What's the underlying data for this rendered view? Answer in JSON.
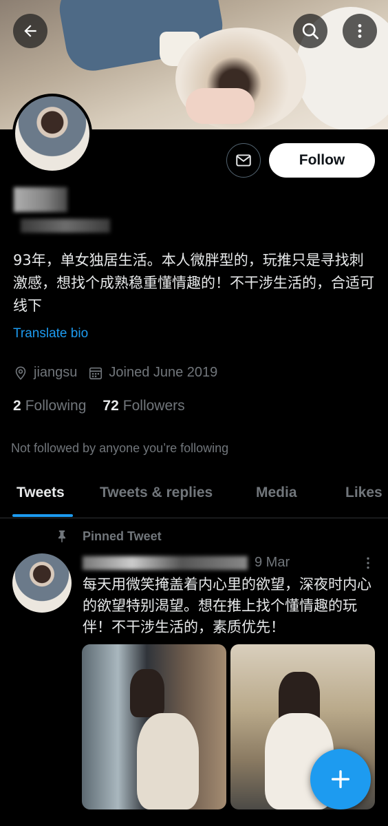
{
  "header": {
    "back_icon": "arrow-left-icon",
    "search_icon": "search-icon",
    "more_icon": "more-vertical-icon"
  },
  "profile": {
    "message_icon": "envelope-icon",
    "follow_label": "Follow",
    "bio": "93年，单女独居生活。本人微胖型的，玩推只是寻找刺激感，想找个成熟稳重懂情趣的！不干涉生活的，合适可线下",
    "translate_label": "Translate bio",
    "location": "jiangsu",
    "joined": "Joined June 2019",
    "following_count": "2",
    "following_label": "Following",
    "followers_count": "72",
    "followers_label": "Followers",
    "not_followed": "Not followed by anyone you’re following"
  },
  "tabs": [
    {
      "label": "Tweets"
    },
    {
      "label": "Tweets & replies"
    },
    {
      "label": "Media"
    },
    {
      "label": "Likes"
    }
  ],
  "pinned_tweet": {
    "pinned_label": "Pinned Tweet",
    "date": "9 Mar",
    "text": "每天用微笑掩盖着内心里的欲望，深夜时内心的欲望特别渴望。想在推上找个懂情趣的玩伴！不干涉生活的，素质优先！"
  },
  "colors": {
    "accent": "#1d9bf0",
    "background": "#000000",
    "text": "#e7e9ea",
    "secondary": "#71767b"
  },
  "fab_icon": "plus-icon"
}
